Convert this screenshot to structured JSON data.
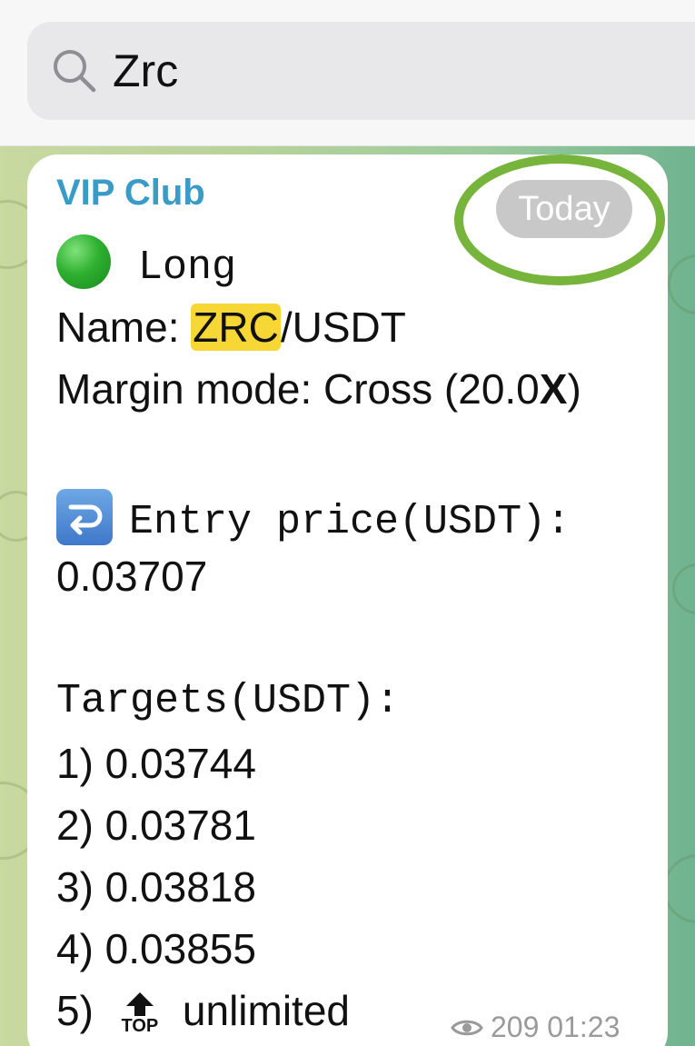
{
  "search": {
    "query": "Zrc",
    "icon": "search-icon"
  },
  "message": {
    "channel": "VIP Club",
    "date_badge": "Today",
    "direction_emoji": "green-circle",
    "direction": "Long",
    "name_label": "Name: ",
    "name_match": "ZRC",
    "name_rest": "/USDT",
    "margin_text": "Margin mode: Cross (20.0",
    "margin_bold": "X",
    "margin_close": ")",
    "entry_emoji": "right-arrow-curving-left",
    "entry_label": "Entry price(USDT):",
    "entry_value": "0.03707",
    "targets_label": "Targets(USDT):",
    "targets": [
      "1) 0.03744",
      "2) 0.03781",
      "3) 0.03818",
      "4) 0.03855"
    ],
    "target_5_prefix": "5)",
    "target_5_icon": "top-arrow-icon",
    "target_5_icon_text": "TOP",
    "target_5_value": "unlimited",
    "views": "209",
    "time": "01:23"
  },
  "colors": {
    "channel_name": "#3a9bc6",
    "highlight": "#f7d736",
    "ring": "#77b43c",
    "date_badge": "#c8c8c8"
  }
}
